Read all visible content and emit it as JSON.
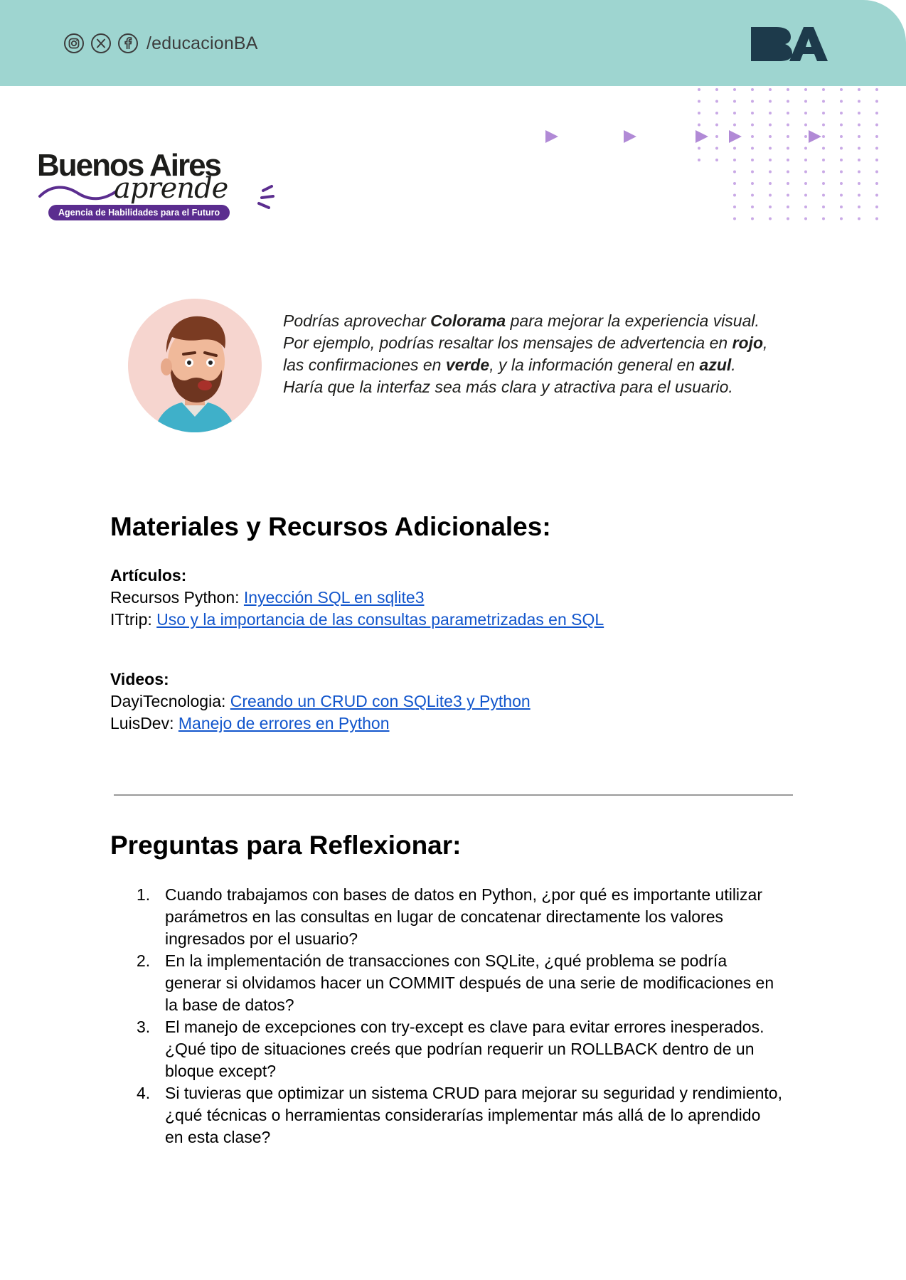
{
  "header": {
    "social_icons": [
      "instagram-icon",
      "x-icon",
      "facebook-icon"
    ],
    "handle": "/educacionBA",
    "logo_text": "BA",
    "colors": {
      "band": "#9ed5d0",
      "logo": "#1d3a4b"
    }
  },
  "brand": {
    "line1": "Buenos Aires",
    "line2": "aprende",
    "tagline": "Agencia de Habilidades para el Futuro",
    "colors": {
      "accent": "#5b2d8f"
    }
  },
  "callout": {
    "lines": [
      [
        {
          "t": "Podrías aprovechar "
        },
        {
          "t": "Colorama",
          "b": true
        },
        {
          "t": " para mejorar la experiencia visual."
        }
      ],
      [
        {
          "t": "Por ejemplo, podrías resaltar los mensajes de advertencia en "
        },
        {
          "t": "rojo",
          "b": true
        },
        {
          "t": ","
        }
      ],
      [
        {
          "t": "las confirmaciones en "
        },
        {
          "t": "verde",
          "b": true
        },
        {
          "t": ", y la información general en "
        },
        {
          "t": "azul",
          "b": true
        },
        {
          "t": "."
        }
      ],
      [
        {
          "t": "Haría que la interfaz sea más clara y atractiva para el usuario."
        }
      ]
    ]
  },
  "materials": {
    "title": "Materiales y Recursos Adicionales:",
    "articles": {
      "label": "Artículos:",
      "items": [
        {
          "source": "Recursos Python: ",
          "link": "Inyección SQL en sqlite3"
        },
        {
          "source": "ITtrip: ",
          "link": "Uso y la importancia de las consultas parametrizadas en SQL"
        }
      ]
    },
    "videos": {
      "label": "Videos:",
      "items": [
        {
          "source": "DayiTecnologia: ",
          "link": "Creando un CRUD con SQLite3 y Python"
        },
        {
          "source": "LuisDev: ",
          "link": "Manejo de errores en Python"
        }
      ]
    }
  },
  "questions": {
    "title": "Preguntas para Reflexionar:",
    "items": [
      {
        "num": "1.",
        "lines": [
          "Cuando trabajamos con bases de datos en Python, ¿por qué es importante utilizar",
          "parámetros en las consultas en lugar de concatenar directamente los valores",
          "ingresados por el usuario?"
        ]
      },
      {
        "num": "2.",
        "lines": [
          "En la implementación de transacciones con SQLite, ¿qué problema se podría",
          "generar si olvidamos hacer un COMMIT después de una serie de modificaciones en",
          "la base de datos?"
        ]
      },
      {
        "num": "3.",
        "lines": [
          "El manejo de excepciones con try-except es clave para evitar errores inesperados.",
          "¿Qué tipo de situaciones creés que podrían requerir un ROLLBACK dentro de un",
          "bloque except?"
        ]
      },
      {
        "num": "4.",
        "lines": [
          "Si tuvieras que optimizar un sistema CRUD para mejorar su seguridad y rendimiento,",
          "¿qué técnicas o herramientas considerarías implementar más allá de lo aprendido",
          "en esta clase?"
        ]
      }
    ]
  },
  "colors": {
    "link": "#1155cc",
    "dots": "#c9a9e6",
    "arrows": "#b18ad6"
  }
}
